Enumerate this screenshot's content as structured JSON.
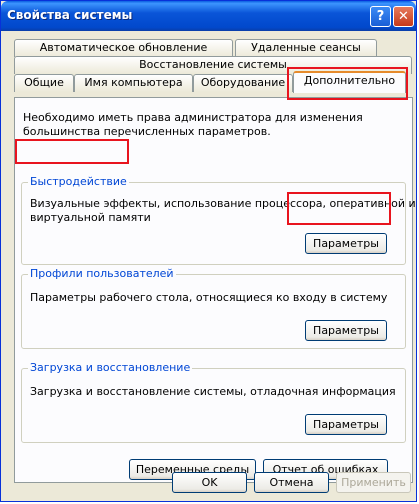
{
  "window": {
    "title": "Свойства системы",
    "help_button": "?",
    "close_button": "✕"
  },
  "tabs": {
    "row1": [
      "Автоматическое обновление",
      "Удаленные сеансы"
    ],
    "row2": [
      "Восстановление системы"
    ],
    "row3": [
      "Общие",
      "Имя компьютера",
      "Оборудование",
      "Дополнительно"
    ],
    "active": "Дополнительно"
  },
  "intro": [
    "Необходимо иметь права администратора для изменения",
    "большинства перечисленных параметров."
  ],
  "groups": [
    {
      "title": "Быстродействие",
      "desc": [
        "Визуальные эффекты, использование процессора, оперативной и",
        "виртуальной памяти"
      ],
      "button": "Параметры"
    },
    {
      "title": "Профили пользователей",
      "desc": [
        "Параметры рабочего стола, относящиеся ко входу в систему"
      ],
      "button": "Параметры"
    },
    {
      "title": "Загрузка и восстановление",
      "desc": [
        "Загрузка и восстановление системы, отладочная информация"
      ],
      "button": "Параметры"
    }
  ],
  "bottom_buttons": {
    "env": "Переменные среды",
    "errors": "Отчет об ошибках"
  },
  "dialog_buttons": {
    "ok": "OK",
    "cancel": "Отмена",
    "apply": "Применить"
  },
  "colors": {
    "titlebar": "#0054e3",
    "group_title": "#0046d5",
    "highlight": "#e8141e",
    "active_tab_accent": "#e68b2c"
  }
}
